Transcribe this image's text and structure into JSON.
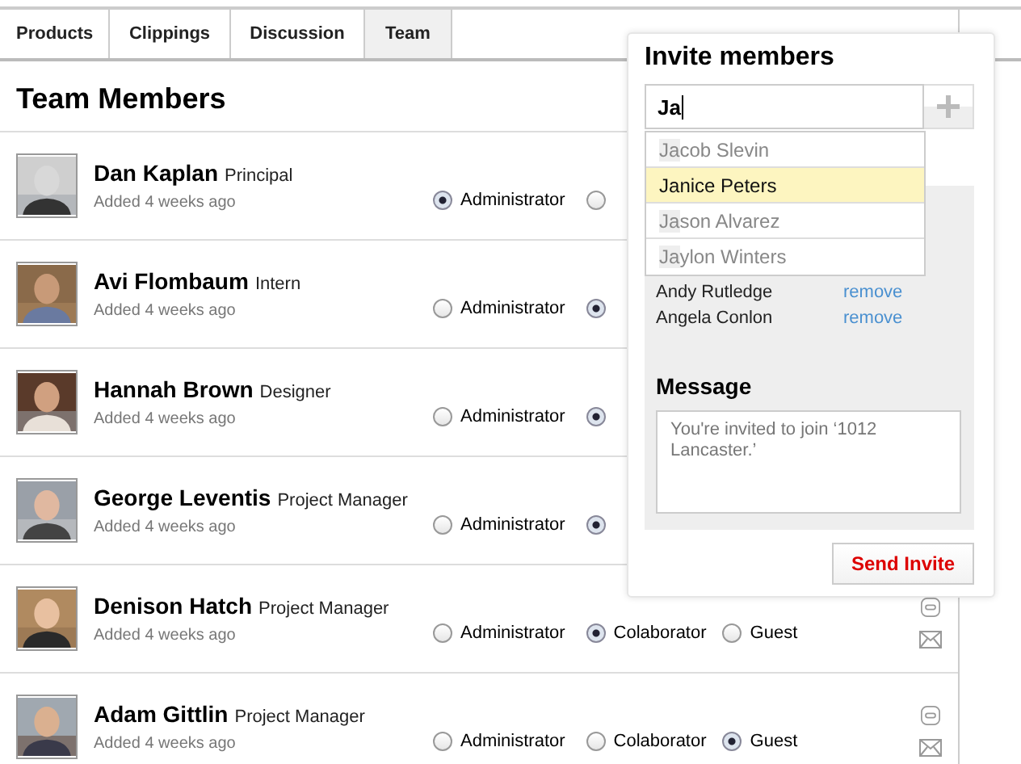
{
  "tabs": [
    {
      "label": "Products",
      "selected": false
    },
    {
      "label": "Clippings",
      "selected": false
    },
    {
      "label": "Discussion",
      "selected": false
    },
    {
      "label": "Team",
      "selected": true
    }
  ],
  "heading": "Team Members",
  "members": [
    {
      "name": "Dan Kaplan",
      "role": "Principal",
      "added": "Added 4 weeks ago",
      "roles": [
        {
          "label": "Administrator",
          "selected": true
        },
        {
          "selected": false
        }
      ]
    },
    {
      "name": "Avi Flombaum",
      "role": "Intern",
      "added": "Added 4 weeks ago",
      "roles": [
        {
          "label": "Administrator",
          "selected": false
        },
        {
          "selected": true
        }
      ]
    },
    {
      "name": "Hannah Brown",
      "role": "Designer",
      "added": "Added 4 weeks ago",
      "roles": [
        {
          "label": "Administrator",
          "selected": false
        },
        {
          "selected": true
        }
      ]
    },
    {
      "name": "George Leventis",
      "role": "Project Manager",
      "added": "Added 4 weeks ago",
      "roles": [
        {
          "label": "Administrator",
          "selected": false
        },
        {
          "selected": true
        }
      ]
    },
    {
      "name": "Denison Hatch",
      "role": "Project Manager",
      "added": "Added 4 weeks ago",
      "roles": [
        {
          "label": "Administrator",
          "selected": false
        },
        {
          "label": "Colaborator",
          "selected": true
        },
        {
          "label": "Guest",
          "selected": false
        }
      ]
    },
    {
      "name": "Adam Gittlin",
      "role": "Project Manager",
      "added": "Added 4 weeks ago",
      "roles": [
        {
          "label": "Administrator",
          "selected": false
        },
        {
          "label": "Colaborator",
          "selected": false
        },
        {
          "label": "Guest",
          "selected": true
        }
      ]
    }
  ],
  "invite": {
    "title": "Invite members",
    "search_value": "Ja",
    "suggestions": [
      {
        "name": "Jacob Slevin",
        "selected": false
      },
      {
        "name": "Janice Peters",
        "selected": true
      },
      {
        "name": "Jason Alvarez",
        "selected": false
      },
      {
        "name": "Jaylon Winters",
        "selected": false
      }
    ],
    "invitees": [
      {
        "name": "Andy Rutledge",
        "action": "remove"
      },
      {
        "name": "Angela Conlon",
        "action": "remove"
      }
    ],
    "message_label": "Message",
    "message": "You're invited to join ‘1012 Lancaster.’",
    "send_button": "Send Invite"
  }
}
